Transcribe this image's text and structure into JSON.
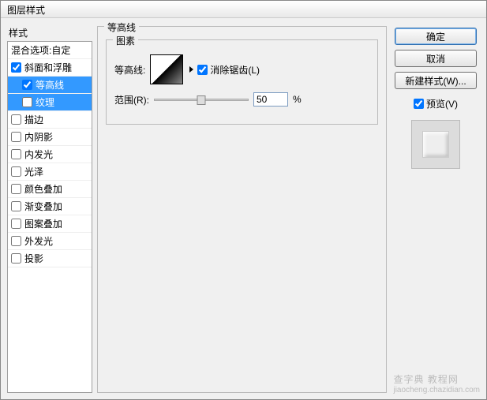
{
  "window": {
    "title": "图层样式"
  },
  "left": {
    "header": "样式",
    "blend": "混合选项:自定",
    "items": [
      {
        "label": "斜面和浮雕",
        "checked": true,
        "selected": false,
        "sub": false
      },
      {
        "label": "等高线",
        "checked": true,
        "selected": true,
        "sub": true
      },
      {
        "label": "纹理",
        "checked": false,
        "selected": true,
        "sub": true
      },
      {
        "label": "描边",
        "checked": false,
        "selected": false,
        "sub": false
      },
      {
        "label": "内阴影",
        "checked": false,
        "selected": false,
        "sub": false
      },
      {
        "label": "内发光",
        "checked": false,
        "selected": false,
        "sub": false
      },
      {
        "label": "光泽",
        "checked": false,
        "selected": false,
        "sub": false
      },
      {
        "label": "颜色叠加",
        "checked": false,
        "selected": false,
        "sub": false
      },
      {
        "label": "渐变叠加",
        "checked": false,
        "selected": false,
        "sub": false
      },
      {
        "label": "图案叠加",
        "checked": false,
        "selected": false,
        "sub": false
      },
      {
        "label": "外发光",
        "checked": false,
        "selected": false,
        "sub": false
      },
      {
        "label": "投影",
        "checked": false,
        "selected": false,
        "sub": false
      }
    ]
  },
  "center": {
    "title": "等高线",
    "elements_title": "图素",
    "contour_label": "等高线:",
    "antialias_label": "消除锯齿(L)",
    "antialias_checked": true,
    "range_label": "范围(R):",
    "range_value": "50",
    "range_unit": "%"
  },
  "right": {
    "ok": "确定",
    "cancel": "取消",
    "newstyle": "新建样式(W)...",
    "preview_label": "预览(V)",
    "preview_checked": true
  },
  "watermark": {
    "main": "查字典 教程网",
    "sub": "jiaocheng.chazidian.com"
  }
}
